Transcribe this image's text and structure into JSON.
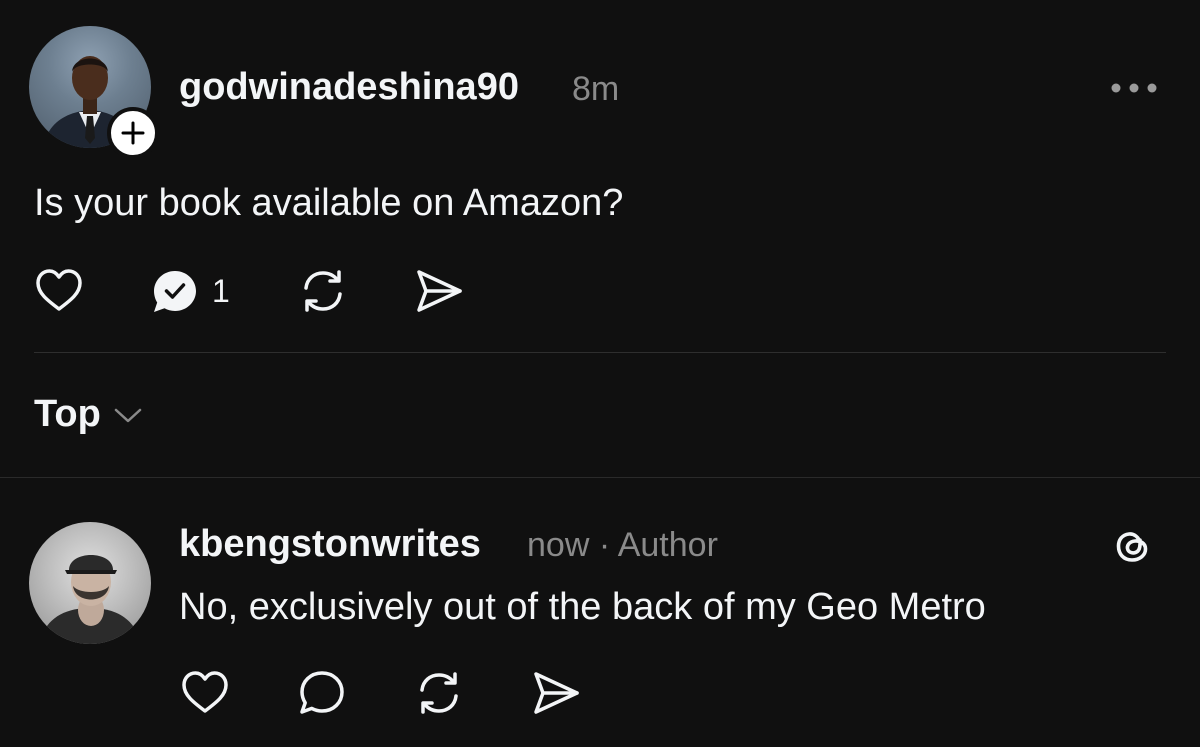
{
  "post": {
    "username": "godwinadeshina90",
    "time": "8m",
    "text": "Is your book available on Amazon?",
    "reply_count": "1",
    "icons": {
      "follow": "plus-icon",
      "more": "more-horizontal-icon",
      "like": "heart-icon",
      "reply": "comment-check-icon",
      "repost": "repost-icon",
      "share": "send-icon"
    }
  },
  "sort": {
    "label": "Top",
    "icon": "chevron-down-icon"
  },
  "reply": {
    "username": "kbengstonwrites",
    "meta": "now · Author",
    "text": "No, exclusively out of the back of my Geo Metro",
    "icons": {
      "app": "threads-icon",
      "like": "heart-icon",
      "reply": "comment-icon",
      "repost": "repost-icon",
      "share": "send-icon"
    }
  },
  "colors": {
    "background": "#101010",
    "text": "#f3f5f7",
    "muted": "#8a8a8a",
    "divider": "#2e2e2e"
  }
}
